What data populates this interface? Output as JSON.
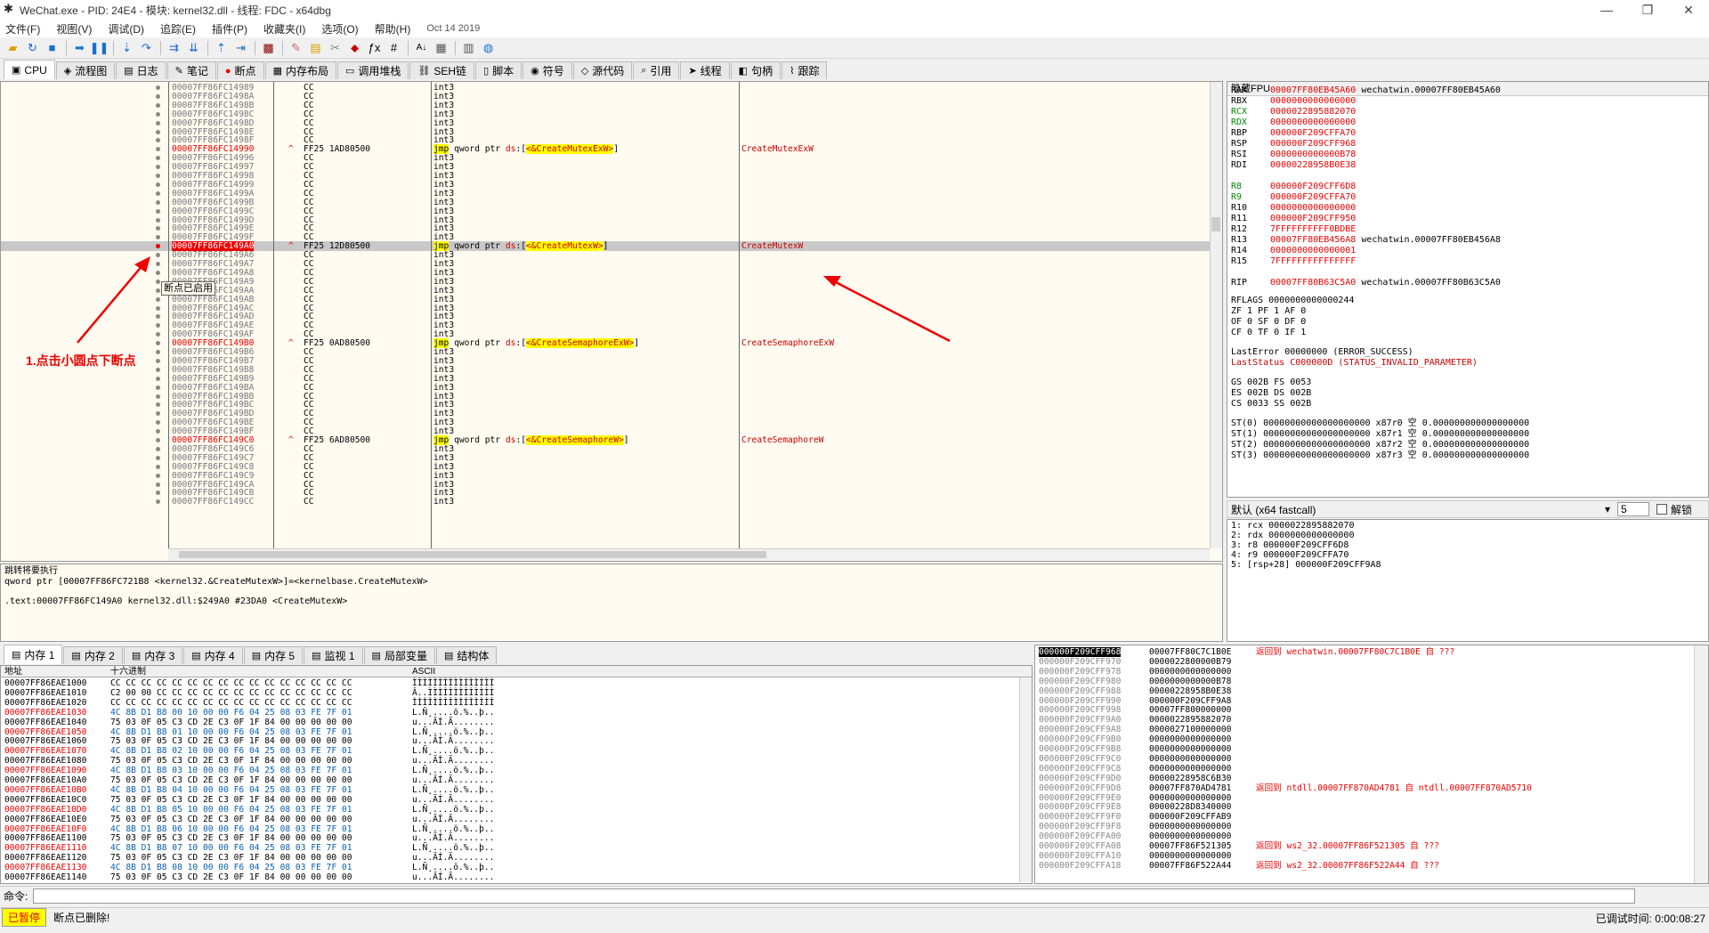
{
  "window": {
    "title": "WeChat.exe - PID: 24E4 - 模块: kernel32.dll - 线程: FDC - x64dbg",
    "min": "—",
    "max": "❐",
    "close": "✕"
  },
  "menu": [
    "文件(F)",
    "视图(V)",
    "调试(D)",
    "追踪(E)",
    "插件(P)",
    "收藏夹(I)",
    "选项(O)",
    "帮助(H)"
  ],
  "menu_date": "Oct 14 2019",
  "tabs": [
    {
      "icon": "cpu-icon",
      "glyph": "▣",
      "label": "CPU"
    },
    {
      "icon": "flowchart-icon",
      "glyph": "◈",
      "label": "流程图"
    },
    {
      "icon": "log-icon",
      "glyph": "▤",
      "label": "日志"
    },
    {
      "icon": "notes-icon",
      "glyph": "✎",
      "label": "笔记"
    },
    {
      "icon": "breakpoint-icon",
      "glyph": "●",
      "label": "断点"
    },
    {
      "icon": "memory-map-icon",
      "glyph": "▦",
      "label": "内存布局"
    },
    {
      "icon": "callstack-icon",
      "glyph": "▭",
      "label": "调用堆栈"
    },
    {
      "icon": "seh-icon",
      "glyph": "⛓",
      "label": "SEH链"
    },
    {
      "icon": "script-icon",
      "glyph": "▯",
      "label": "脚本"
    },
    {
      "icon": "symbol-icon",
      "glyph": "◉",
      "label": "符号"
    },
    {
      "icon": "source-icon",
      "glyph": "◇",
      "label": "源代码"
    },
    {
      "icon": "reference-icon",
      "glyph": "⌕",
      "label": "引用"
    },
    {
      "icon": "thread-icon",
      "glyph": "➤",
      "label": "线程"
    },
    {
      "icon": "handle-icon",
      "glyph": "◧",
      "label": "句柄"
    },
    {
      "icon": "trace-icon",
      "glyph": "⌇",
      "label": "跟踪"
    }
  ],
  "disasm": {
    "tooltip": "断点已启用",
    "annotation": "1.点击小圆点下断点",
    "rows": [
      {
        "addr": "00007FF86FC14989",
        "bytes": "CC",
        "instr": "int3"
      },
      {
        "addr": "00007FF86FC1498A",
        "bytes": "CC",
        "instr": "int3"
      },
      {
        "addr": "00007FF86FC1498B",
        "bytes": "CC",
        "instr": "int3"
      },
      {
        "addr": "00007FF86FC1498C",
        "bytes": "CC",
        "instr": "int3"
      },
      {
        "addr": "00007FF86FC1498D",
        "bytes": "CC",
        "instr": "int3"
      },
      {
        "addr": "00007FF86FC1498E",
        "bytes": "CC",
        "instr": "int3"
      },
      {
        "addr": "00007FF86FC1498F",
        "bytes": "CC",
        "instr": "int3"
      },
      {
        "addr": "00007FF86FC14990",
        "label": true,
        "bytes": "FF25 1AD80500",
        "jmp": "CreateMutexExW",
        "cmt": "CreateMutexExW"
      },
      {
        "addr": "00007FF86FC14996",
        "bytes": "CC",
        "instr": "int3"
      },
      {
        "addr": "00007FF86FC14997",
        "bytes": "CC",
        "instr": "int3"
      },
      {
        "addr": "00007FF86FC14998",
        "bytes": "CC",
        "instr": "int3"
      },
      {
        "addr": "00007FF86FC14999",
        "bytes": "CC",
        "instr": "int3"
      },
      {
        "addr": "00007FF86FC1499A",
        "bytes": "CC",
        "instr": "int3"
      },
      {
        "addr": "00007FF86FC1499B",
        "bytes": "CC",
        "instr": "int3"
      },
      {
        "addr": "00007FF86FC1499C",
        "bytes": "CC",
        "instr": "int3"
      },
      {
        "addr": "00007FF86FC1499D",
        "bytes": "CC",
        "instr": "int3"
      },
      {
        "addr": "00007FF86FC1499E",
        "bytes": "CC",
        "instr": "int3"
      },
      {
        "addr": "00007FF86FC1499F",
        "bytes": "CC",
        "instr": "int3"
      },
      {
        "addr": "00007FF86FC149A0",
        "label": true,
        "bp": true,
        "sel": true,
        "bytes": "FF25 12D80500",
        "jmp": "CreateMutexW",
        "cmt": "CreateMutexW"
      },
      {
        "addr": "00007FF86FC149A6",
        "bytes": "CC",
        "instr": "int3"
      },
      {
        "addr": "00007FF86FC149A7",
        "bytes": "CC",
        "instr": "int3"
      },
      {
        "addr": "00007FF86FC149A8",
        "bytes": "CC",
        "instr": "int3"
      },
      {
        "addr": "00007FF86FC149A9",
        "bytes": "CC",
        "instr": "int3"
      },
      {
        "addr": "00007FF86FC149AA",
        "bytes": "CC",
        "instr": "int3"
      },
      {
        "addr": "00007FF86FC149AB",
        "bytes": "CC",
        "instr": "int3"
      },
      {
        "addr": "00007FF86FC149AC",
        "bytes": "CC",
        "instr": "int3"
      },
      {
        "addr": "00007FF86FC149AD",
        "bytes": "CC",
        "instr": "int3"
      },
      {
        "addr": "00007FF86FC149AE",
        "bytes": "CC",
        "instr": "int3"
      },
      {
        "addr": "00007FF86FC149AF",
        "bytes": "CC",
        "instr": "int3"
      },
      {
        "addr": "00007FF86FC149B0",
        "label": true,
        "bytes": "FF25 0AD80500",
        "jmp": "CreateSemaphoreExW",
        "cmt": "CreateSemaphoreExW"
      },
      {
        "addr": "00007FF86FC149B6",
        "bytes": "CC",
        "instr": "int3"
      },
      {
        "addr": "00007FF86FC149B7",
        "bytes": "CC",
        "instr": "int3"
      },
      {
        "addr": "00007FF86FC149B8",
        "bytes": "CC",
        "instr": "int3"
      },
      {
        "addr": "00007FF86FC149B9",
        "bytes": "CC",
        "instr": "int3"
      },
      {
        "addr": "00007FF86FC149BA",
        "bytes": "CC",
        "instr": "int3"
      },
      {
        "addr": "00007FF86FC149BB",
        "bytes": "CC",
        "instr": "int3"
      },
      {
        "addr": "00007FF86FC149BC",
        "bytes": "CC",
        "instr": "int3"
      },
      {
        "addr": "00007FF86FC149BD",
        "bytes": "CC",
        "instr": "int3"
      },
      {
        "addr": "00007FF86FC149BE",
        "bytes": "CC",
        "instr": "int3"
      },
      {
        "addr": "00007FF86FC149BF",
        "bytes": "CC",
        "instr": "int3"
      },
      {
        "addr": "00007FF86FC149C0",
        "label": true,
        "bytes": "FF25 6AD80500",
        "jmp": "CreateSemaphoreW",
        "cmt": "CreateSemaphoreW"
      },
      {
        "addr": "00007FF86FC149C6",
        "bytes": "CC",
        "instr": "int3"
      },
      {
        "addr": "00007FF86FC149C7",
        "bytes": "CC",
        "instr": "int3"
      },
      {
        "addr": "00007FF86FC149C8",
        "bytes": "CC",
        "instr": "int3"
      },
      {
        "addr": "00007FF86FC149C9",
        "bytes": "CC",
        "instr": "int3"
      },
      {
        "addr": "00007FF86FC149CA",
        "bytes": "CC",
        "instr": "int3"
      },
      {
        "addr": "00007FF86FC149CB",
        "bytes": "CC",
        "instr": "int3"
      },
      {
        "addr": "00007FF86FC149CC",
        "bytes": "CC",
        "instr": "int3"
      }
    ]
  },
  "info": {
    "line1": "跳转将要执行",
    "line2": "qword ptr [00007FF86FC721B8 <kernel32.&CreateMutexW>]=<kernelbase.CreateMutexW>",
    "line3": ".text:00007FF86FC149A0 kernel32.dll:$249A0 #23DA0 <CreateMutexW>"
  },
  "regs": {
    "header": "隐藏FPU",
    "lines": [
      {
        "n": "RAX",
        "v": "00007FF80EB45A60",
        "c": "wechatwin.00007FF80EB45A60"
      },
      {
        "n": "RBX",
        "v": "0000000000000000",
        "c": ""
      },
      {
        "n": "RCX",
        "v": "0000022895882070",
        "c": "",
        "g": true
      },
      {
        "n": "RDX",
        "v": "0000000000000000",
        "c": "",
        "g": true
      },
      {
        "n": "RBP",
        "v": "000000F209CFFA70",
        "c": ""
      },
      {
        "n": "RSP",
        "v": "000000F209CFF968",
        "c": ""
      },
      {
        "n": "RSI",
        "v": "0000000000000B78",
        "c": ""
      },
      {
        "n": "RDI",
        "v": "00000228958B0E38",
        "c": ""
      },
      {
        "n": "",
        "v": "",
        "c": ""
      },
      {
        "n": "R8",
        "v": "000000F209CFF6D8",
        "c": "",
        "g": true
      },
      {
        "n": "R9",
        "v": "000000F209CFFA70",
        "c": "",
        "g": true
      },
      {
        "n": "R10",
        "v": "0000000000000000",
        "c": ""
      },
      {
        "n": "R11",
        "v": "000000F209CFF950",
        "c": ""
      },
      {
        "n": "R12",
        "v": "7FFFFFFFFFF0BDBE",
        "c": ""
      },
      {
        "n": "R13",
        "v": "00007FF80EB456A8",
        "c": "wechatwin.00007FF80EB456A8"
      },
      {
        "n": "R14",
        "v": "0000000000000001",
        "c": ""
      },
      {
        "n": "R15",
        "v": "7FFFFFFFFFFFFFFF",
        "c": ""
      },
      {
        "n": "",
        "v": "",
        "c": ""
      },
      {
        "n": "RIP",
        "v": "00007FF80B63C5A0",
        "c": "wechatwin.00007FF80B63C5A0"
      }
    ],
    "flags": [
      "RFLAGS  0000000000000244",
      "ZF 1  PF 1  AF 0",
      "OF 0  SF 0  DF 0",
      "CF 0  TF 0  IF 1"
    ],
    "err": [
      "LastError  00000000 (ERROR_SUCCESS)",
      "LastStatus C000000D (STATUS_INVALID_PARAMETER)"
    ],
    "seg": [
      "GS 002B  FS 0053",
      "ES 002B  DS 002B",
      "CS 0033  SS 002B"
    ],
    "fpu": [
      "ST(0) 00000000000000000000 x87r0 空 0.000000000000000000",
      "ST(1) 00000000000000000000 x87r1 空 0.000000000000000000",
      "ST(2) 00000000000000000000 x87r2 空 0.000000000000000000",
      "ST(3) 00000000000000000000 x87r3 空 0.000000000000000000"
    ]
  },
  "callconv": {
    "label": "默认 (x64 fastcall)",
    "count": "5",
    "unlock": "解锁"
  },
  "args": [
    "1: rcx 0000022895882070",
    "2: rdx 0000000000000000",
    "3: r8 000000F209CFF6D8",
    "4: r9 000000F209CFFA70",
    "5: [rsp+28] 000000F209CFF9A8"
  ],
  "memtabs": [
    {
      "icon": "memory-icon",
      "label": "内存 1"
    },
    {
      "icon": "memory-icon",
      "label": "内存 2"
    },
    {
      "icon": "memory-icon",
      "label": "内存 3"
    },
    {
      "icon": "memory-icon",
      "label": "内存 4"
    },
    {
      "icon": "memory-icon",
      "label": "内存 5"
    },
    {
      "icon": "watch-icon",
      "label": "监视 1"
    },
    {
      "icon": "locals-icon",
      "label": "局部变量"
    },
    {
      "icon": "struct-icon",
      "label": "结构体"
    }
  ],
  "dump": {
    "h_addr": "地址",
    "h_hex": "十六进制",
    "h_ascii": "ASCII",
    "rows": [
      {
        "a": "00007FF86EAE1000",
        "h": "CC CC CC CC CC CC CC CC CC CC CC CC CC CC CC CC",
        "s": "ÌÌÌÌÌÌÌÌÌÌÌÌÌÌÌÌ"
      },
      {
        "a": "00007FF86EAE1010",
        "h": "C2 00 00 CC CC CC CC CC CC CC CC CC CC CC CC CC",
        "s": "Â..ÌÌÌÌÌÌÌÌÌÌÌÌÌ"
      },
      {
        "a": "00007FF86EAE1020",
        "h": "CC CC CC CC CC CC CC CC CC CC CC CC CC CC CC CC",
        "s": "ÌÌÌÌÌÌÌÌÌÌÌÌÌÌÌÌ"
      },
      {
        "a": "00007FF86EAE1030",
        "r": true,
        "h": "4C 8B D1 B8 00 10 00 00 F6 04 25 08 03 FE 7F 01",
        "s": "L.Ñ¸....ö.%..þ.."
      },
      {
        "a": "00007FF86EAE1040",
        "h": "75 03 0F 05 C3 CD 2E C3 0F 1F 84 00 00 00 00 00",
        "s": "u...ÃÍ.Ã........"
      },
      {
        "a": "00007FF86EAE1050",
        "r": true,
        "h": "4C 8B D1 B8 01 10 00 00 F6 04 25 08 03 FE 7F 01",
        "s": "L.Ñ¸....ö.%..þ.."
      },
      {
        "a": "00007FF86EAE1060",
        "h": "75 03 0F 05 C3 CD 2E C3 0F 1F 84 00 00 00 00 00",
        "s": "u...ÃÍ.Ã........"
      },
      {
        "a": "00007FF86EAE1070",
        "r": true,
        "h": "4C 8B D1 B8 02 10 00 00 F6 04 25 08 03 FE 7F 01",
        "s": "L.Ñ¸....ö.%..þ.."
      },
      {
        "a": "00007FF86EAE1080",
        "h": "75 03 0F 05 C3 CD 2E C3 0F 1F 84 00 00 00 00 00",
        "s": "u...ÃÍ.Ã........"
      },
      {
        "a": "00007FF86EAE1090",
        "r": true,
        "h": "4C 8B D1 B8 03 10 00 00 F6 04 25 08 03 FE 7F 01",
        "s": "L.Ñ¸....ö.%..þ.."
      },
      {
        "a": "00007FF86EAE10A0",
        "h": "75 03 0F 05 C3 CD 2E C3 0F 1F 84 00 00 00 00 00",
        "s": "u...ÃÍ.Ã........"
      },
      {
        "a": "00007FF86EAE10B0",
        "r": true,
        "h": "4C 8B D1 B8 04 10 00 00 F6 04 25 08 03 FE 7F 01",
        "s": "L.Ñ¸....ö.%..þ.."
      },
      {
        "a": "00007FF86EAE10C0",
        "h": "75 03 0F 05 C3 CD 2E C3 0F 1F 84 00 00 00 00 00",
        "s": "u...ÃÍ.Ã........"
      },
      {
        "a": "00007FF86EAE10D0",
        "r": true,
        "h": "4C 8B D1 B8 05 10 00 00 F6 04 25 08 03 FE 7F 01",
        "s": "L.Ñ¸....ö.%..þ.."
      },
      {
        "a": "00007FF86EAE10E0",
        "h": "75 03 0F 05 C3 CD 2E C3 0F 1F 84 00 00 00 00 00",
        "s": "u...ÃÍ.Ã........"
      },
      {
        "a": "00007FF86EAE10F0",
        "r": true,
        "h": "4C 8B D1 B8 06 10 00 00 F6 04 25 08 03 FE 7F 01",
        "s": "L.Ñ¸....ö.%..þ.."
      },
      {
        "a": "00007FF86EAE1100",
        "h": "75 03 0F 05 C3 CD 2E C3 0F 1F 84 00 00 00 00 00",
        "s": "u...ÃÍ.Ã........"
      },
      {
        "a": "00007FF86EAE1110",
        "r": true,
        "h": "4C 8B D1 B8 07 10 00 00 F6 04 25 08 03 FE 7F 01",
        "s": "L.Ñ¸....ö.%..þ.."
      },
      {
        "a": "00007FF86EAE1120",
        "h": "75 03 0F 05 C3 CD 2E C3 0F 1F 84 00 00 00 00 00",
        "s": "u...ÃÍ.Ã........"
      },
      {
        "a": "00007FF86EAE1130",
        "r": true,
        "h": "4C 8B D1 B8 08 10 00 00 F6 04 25 08 03 FE 7F 01",
        "s": "L.Ñ¸....ö.%..þ.."
      },
      {
        "a": "00007FF86EAE1140",
        "h": "75 03 0F 05 C3 CD 2E C3 0F 1F 84 00 00 00 00 00",
        "s": "u...ÃÍ.Ã........"
      }
    ]
  },
  "stack": {
    "rows": [
      {
        "a": "000000F209CFF968",
        "top": true,
        "v": "00007FF80C7C1B0E",
        "c": "返回到 wechatwin.00007FF80C7C1B0E 自 ???"
      },
      {
        "a": "000000F209CFF970",
        "v": "0000022800000B79",
        "c": ""
      },
      {
        "a": "000000F209CFF978",
        "v": "0000000000000000",
        "c": ""
      },
      {
        "a": "000000F209CFF980",
        "v": "0000000000000B78",
        "c": ""
      },
      {
        "a": "000000F209CFF988",
        "v": "00000228958B0E38",
        "c": ""
      },
      {
        "a": "000000F209CFF990",
        "v": "000000F209CFF9A8",
        "c": ""
      },
      {
        "a": "000000F209CFF998",
        "v": "00007FF800000000",
        "c": ""
      },
      {
        "a": "000000F209CFF9A0",
        "v": "0000022895882070",
        "c": ""
      },
      {
        "a": "000000F209CFF9A8",
        "v": "0000027100000000",
        "c": ""
      },
      {
        "a": "000000F209CFF9B0",
        "v": "0000000000000000",
        "c": ""
      },
      {
        "a": "000000F209CFF9B8",
        "v": "0000000000000000",
        "c": ""
      },
      {
        "a": "000000F209CFF9C0",
        "v": "0000000000000000",
        "c": ""
      },
      {
        "a": "000000F209CFF9C8",
        "v": "0000000000000000",
        "c": ""
      },
      {
        "a": "000000F209CFF9D0",
        "v": "00000228958C6B30",
        "c": ""
      },
      {
        "a": "000000F209CFF9D8",
        "v": "00007FF870AD4781",
        "c": "返回到 ntdll.00007FF870AD4781 自 ntdll.00007FF870AD5710"
      },
      {
        "a": "000000F209CFF9E0",
        "v": "0000000000000000",
        "c": ""
      },
      {
        "a": "000000F209CFF9E8",
        "v": "00000228D8340000",
        "c": ""
      },
      {
        "a": "000000F209CFF9F0",
        "v": "000000F209CFFAB9",
        "c": ""
      },
      {
        "a": "000000F209CFF9F8",
        "v": "0000000000000000",
        "c": ""
      },
      {
        "a": "000000F209CFFA00",
        "v": "0000000000000000",
        "c": ""
      },
      {
        "a": "000000F209CFFA08",
        "v": "00007FF86F521305",
        "c": "返回到 ws2_32.00007FF86F521305 自 ???"
      },
      {
        "a": "000000F209CFFA10",
        "v": "0000000000000000",
        "c": ""
      },
      {
        "a": "000000F209CFFA18",
        "v": "00007FF86F522A44",
        "c": "返回到 ws2_32.00007FF86F522A44 自 ???"
      }
    ]
  },
  "cmd": {
    "label": "命令:"
  },
  "status": {
    "paused": "已暂停",
    "message": "断点已删除!",
    "elapsed": "已调试时间: 0:00:08:27"
  }
}
